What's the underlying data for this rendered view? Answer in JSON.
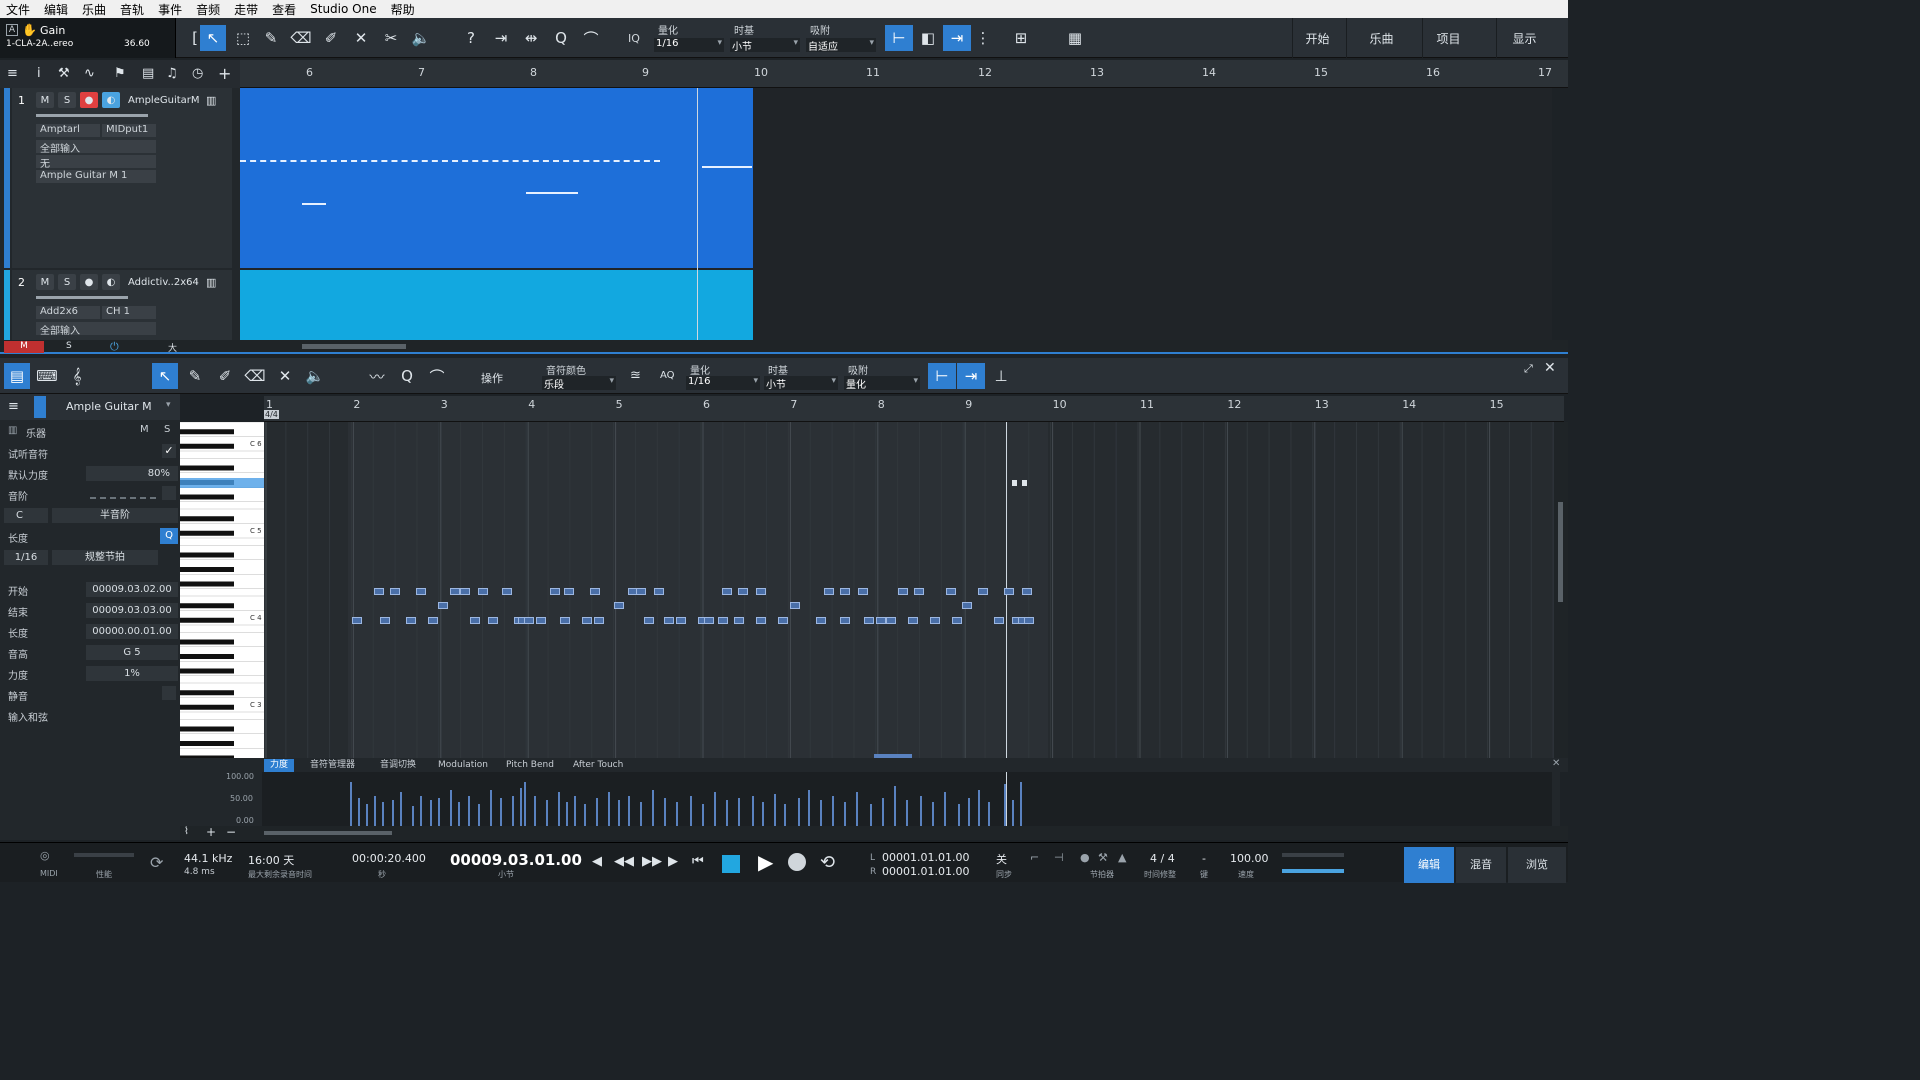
{
  "menubar": [
    "文件",
    "编辑",
    "乐曲",
    "音轨",
    "事件",
    "音频",
    "走带",
    "查看",
    "Studio One",
    "帮助"
  ],
  "gainbox": {
    "title": "Gain",
    "plugin": "1-CLA-2A..ereo",
    "value": "36.60"
  },
  "toolbar": {
    "quantize_label": "量化",
    "quantize_value": "1/16",
    "timebase_label": "时基",
    "timebase_value": "小节",
    "snap_label": "吸附",
    "snap_value": "自适应",
    "iq": "IQ",
    "right_tabs": [
      "开始",
      "乐曲",
      "项目",
      "显示"
    ]
  },
  "arrange_ruler": [
    "6",
    "7",
    "8",
    "9",
    "10",
    "11",
    "12",
    "13",
    "14",
    "15",
    "16",
    "17"
  ],
  "tracks": [
    {
      "num": "1",
      "name": "AmpleGuitarM",
      "in1": "Amptarl",
      "in2": "MIDput1",
      "input": "全部输入",
      "none": "无",
      "out": "Ample Guitar M 1"
    },
    {
      "num": "2",
      "name": "Addictiv..2x64",
      "in1": "Add2x6",
      "in2": "CH 1",
      "input": "全部输入"
    }
  ],
  "arrange_bottom": {
    "m": "M",
    "s": "S",
    "big": "大"
  },
  "editor_toolbar": {
    "ops": "操作",
    "note_color_label": "音符颜色",
    "note_color_value": "乐段",
    "aq": "AQ",
    "quantize_label": "量化",
    "quantize_value": "1/16",
    "timebase_label": "时基",
    "timebase_value": "小节",
    "snap_label": "吸附",
    "snap_value": "量化"
  },
  "inspector": {
    "instrument_track": "Ample Guitar M",
    "instrument": "乐器",
    "m": "M",
    "s": "S",
    "audition": "试听音符",
    "default_velocity": "默认力度",
    "default_velocity_value": "80%",
    "scale": "音阶",
    "key": "C",
    "scale_type": "半音阶",
    "length": "长度",
    "length_value": "1/16",
    "length_mode": "规整节拍",
    "start": "开始",
    "start_value": "00009.03.02.00",
    "end": "结束",
    "end_value": "00009.03.03.00",
    "len2": "长度",
    "len2_value": "00000.00.01.00",
    "pitch": "音高",
    "pitch_value": "G 5",
    "velocity": "力度",
    "velocity_value": "1%",
    "mute": "静音",
    "input_chord": "输入和弦"
  },
  "piano_labels": [
    "C 6",
    "C 5",
    "C 4",
    "C 3"
  ],
  "editor_ruler": [
    "1",
    "2",
    "3",
    "4",
    "5",
    "6",
    "7",
    "8",
    "9",
    "10",
    "11",
    "12",
    "13",
    "14",
    "15"
  ],
  "time_sig": "4/4",
  "vel_tabs": [
    "力度",
    "音符管理器",
    "音调切换",
    "Modulation",
    "Pitch Bend",
    "After Touch"
  ],
  "vel_axis": [
    "100.00",
    "50.00",
    "0.00"
  ],
  "transport": {
    "midi": "MIDI",
    "perf": "性能",
    "sample_rate": "44.1 kHz",
    "latency": "4.8 ms",
    "rec_time": "16:00 天",
    "rec_label": "最大剩余录音时间",
    "seconds": "00:00:20.400",
    "seconds_label": "秒",
    "bars": "00009.03.01.00",
    "bars_label": "小节",
    "loop_l": "00001.01.01.00",
    "loop_r": "00001.01.01.00",
    "L": "L",
    "R": "R",
    "off": "关",
    "sync": "同步",
    "metronome": "节拍器",
    "timesig": "4 / 4",
    "timesig_label": "时间修整",
    "key_label": "键",
    "dash": "-",
    "tempo": "100.00",
    "tempo_label": "速度",
    "tabs": [
      "编辑",
      "混音",
      "浏览"
    ]
  }
}
